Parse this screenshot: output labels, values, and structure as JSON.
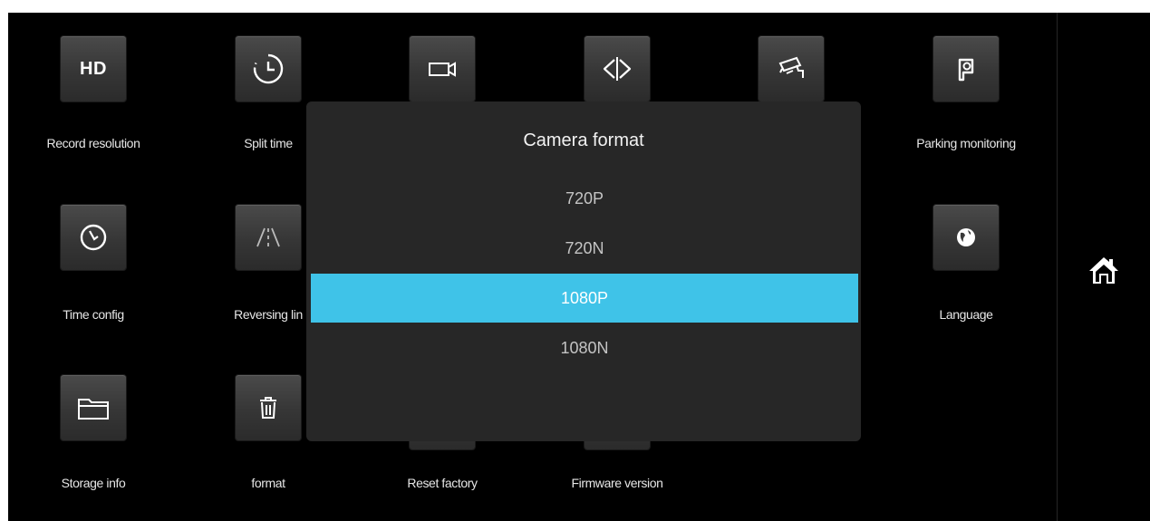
{
  "menu": {
    "items": [
      {
        "label": "Record resolution",
        "icon": "hd-icon",
        "icon_text": "HD"
      },
      {
        "label": "Split time",
        "icon": "clock-timer-icon"
      },
      {
        "label": "",
        "icon": "video-camera-icon"
      },
      {
        "label": "",
        "icon": "mirror-flip-icon"
      },
      {
        "label": "",
        "icon": "security-camera-icon"
      },
      {
        "label": "Parking monitoring",
        "icon": "parking-icon"
      },
      {
        "label": "Time config",
        "icon": "clock-icon"
      },
      {
        "label": "Reversing lin",
        "icon": "reversing-lines-icon"
      },
      {
        "label": "Language",
        "icon": "globe-icon"
      },
      {
        "label": "Storage info",
        "icon": "folder-icon"
      },
      {
        "label": "format",
        "icon": "trash-icon"
      },
      {
        "label": "Reset factory",
        "icon": "reset-icon"
      },
      {
        "label": "Firmware version",
        "icon": "firmware-icon"
      }
    ]
  },
  "dialog": {
    "title": "Camera format",
    "options": [
      "720P",
      "720N",
      "1080P",
      "1080N"
    ],
    "selected": "1080P"
  },
  "home": {
    "icon": "home-icon"
  },
  "colors": {
    "background": "#000000",
    "dialog": "#272727",
    "highlight": "#3fc3e8",
    "tile": "#3a3a3a"
  }
}
